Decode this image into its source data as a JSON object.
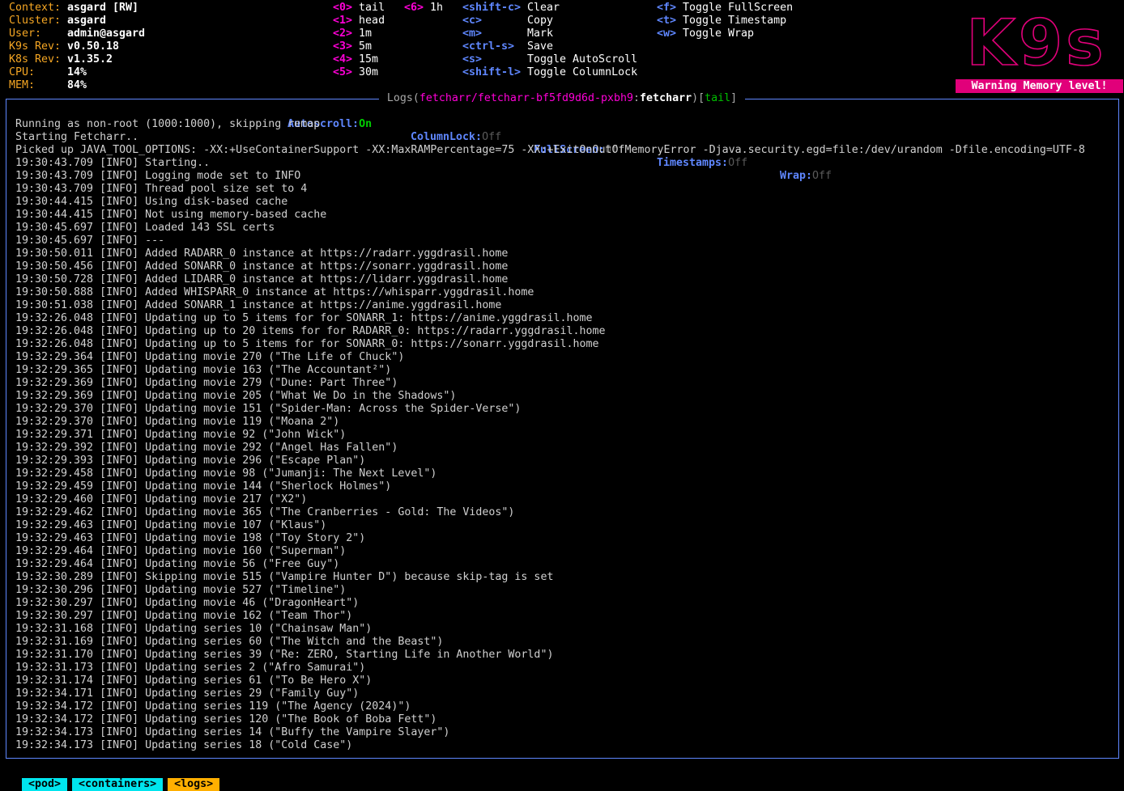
{
  "header": {
    "info": [
      {
        "label": "Context:",
        "value": "asgard [RW]"
      },
      {
        "label": "Cluster:",
        "value": "asgard"
      },
      {
        "label": "User:",
        "value": "admin@asgard"
      },
      {
        "label": "K9s Rev:",
        "value": "v0.50.18"
      },
      {
        "label": "K8s Rev:",
        "value": "v1.35.2"
      },
      {
        "label": "CPU:",
        "value": "14%"
      },
      {
        "label": "MEM:",
        "value": "84%"
      }
    ],
    "keybindings_col1": [
      {
        "key": "<0>",
        "desc": "tail"
      },
      {
        "key": "<1>",
        "desc": "head"
      },
      {
        "key": "<2>",
        "desc": "1m"
      },
      {
        "key": "<3>",
        "desc": "5m"
      },
      {
        "key": "<4>",
        "desc": "15m"
      },
      {
        "key": "<5>",
        "desc": "30m"
      }
    ],
    "keybindings_col2": [
      {
        "key": "<6>",
        "desc": "1h"
      }
    ],
    "keybindings_col3": [
      {
        "key": "<shift-c>",
        "desc": "Clear"
      },
      {
        "key": "<c>",
        "desc": "Copy"
      },
      {
        "key": "<m>",
        "desc": "Mark"
      },
      {
        "key": "<ctrl-s>",
        "desc": "Save"
      },
      {
        "key": "<s>",
        "desc": "Toggle AutoScroll"
      },
      {
        "key": "<shift-l>",
        "desc": "Toggle ColumnLock"
      }
    ],
    "keybindings_col4": [
      {
        "key": "<f>",
        "desc": "Toggle FullScreen"
      },
      {
        "key": "<t>",
        "desc": "Toggle Timestamp"
      },
      {
        "key": "<w>",
        "desc": "Toggle Wrap"
      }
    ],
    "logo_text": "K9s",
    "warning": "Warning Memory level!"
  },
  "frame": {
    "title_prefix": "Logs(",
    "title_path": "fetcharr/fetcharr-bf5fd9d6d-pxbh9",
    "title_sep": ":",
    "title_container": "fetcharr",
    "title_close": ")",
    "title_mode_open": "[",
    "title_mode": "tail",
    "title_mode_close": "]"
  },
  "status": [
    {
      "label": "Autoscroll:",
      "value": "On"
    },
    {
      "label": "ColumnLock:",
      "value": "Off"
    },
    {
      "label": "FullScreen:",
      "value": "Off"
    },
    {
      "label": "Timestamps:",
      "value": "Off"
    },
    {
      "label": "Wrap:",
      "value": "Off"
    }
  ],
  "logs": [
    "Running as non-root (1000:1000), skipping remap",
    "Starting Fetcharr..",
    "Picked up JAVA_TOOL_OPTIONS: -XX:+UseContainerSupport -XX:MaxRAMPercentage=75 -XX:+ExitOnOutOfMemoryError -Djava.security.egd=file:/dev/urandom -Dfile.encoding=UTF-8",
    "19:30:43.709 [INFO] Starting..",
    "19:30:43.709 [INFO] Logging mode set to INFO",
    "19:30:43.709 [INFO] Thread pool size set to 4",
    "19:30:44.415 [INFO] Using disk-based cache",
    "19:30:44.415 [INFO] Not using memory-based cache",
    "19:30:45.697 [INFO] Loaded 143 SSL certs",
    "19:30:45.697 [INFO] ---",
    "19:30:50.011 [INFO] Added RADARR_0 instance at https://radarr.yggdrasil.home",
    "19:30:50.456 [INFO] Added SONARR_0 instance at https://sonarr.yggdrasil.home",
    "19:30:50.728 [INFO] Added LIDARR_0 instance at https://lidarr.yggdrasil.home",
    "19:30:50.888 [INFO] Added WHISPARR_0 instance at https://whisparr.yggdrasil.home",
    "19:30:51.038 [INFO] Added SONARR_1 instance at https://anime.yggdrasil.home",
    "19:32:26.048 [INFO] Updating up to 5 items for for SONARR_1: https://anime.yggdrasil.home",
    "19:32:26.048 [INFO] Updating up to 20 items for for RADARR_0: https://radarr.yggdrasil.home",
    "19:32:26.048 [INFO] Updating up to 5 items for for SONARR_0: https://sonarr.yggdrasil.home",
    "19:32:29.364 [INFO] Updating movie 270 (\"The Life of Chuck\")",
    "19:32:29.365 [INFO] Updating movie 163 (\"The Accountant²\")",
    "19:32:29.369 [INFO] Updating movie 279 (\"Dune: Part Three\")",
    "19:32:29.369 [INFO] Updating movie 205 (\"What We Do in the Shadows\")",
    "19:32:29.370 [INFO] Updating movie 151 (\"Spider-Man: Across the Spider-Verse\")",
    "19:32:29.370 [INFO] Updating movie 119 (\"Moana 2\")",
    "19:32:29.371 [INFO] Updating movie 92 (\"John Wick\")",
    "19:32:29.392 [INFO] Updating movie 292 (\"Angel Has Fallen\")",
    "19:32:29.393 [INFO] Updating movie 296 (\"Escape Plan\")",
    "19:32:29.458 [INFO] Updating movie 98 (\"Jumanji: The Next Level\")",
    "19:32:29.459 [INFO] Updating movie 144 (\"Sherlock Holmes\")",
    "19:32:29.460 [INFO] Updating movie 217 (\"X2\")",
    "19:32:29.462 [INFO] Updating movie 365 (\"The Cranberries - Gold: The Videos\")",
    "19:32:29.463 [INFO] Updating movie 107 (\"Klaus\")",
    "19:32:29.463 [INFO] Updating movie 198 (\"Toy Story 2\")",
    "19:32:29.464 [INFO] Updating movie 160 (\"Superman\")",
    "19:32:29.464 [INFO] Updating movie 56 (\"Free Guy\")",
    "19:32:30.289 [INFO] Skipping movie 515 (\"Vampire Hunter D\") because skip-tag is set",
    "19:32:30.296 [INFO] Updating movie 527 (\"Timeline\")",
    "19:32:30.297 [INFO] Updating movie 46 (\"DragonHeart\")",
    "19:32:30.297 [INFO] Updating movie 162 (\"Team Thor\")",
    "19:32:31.168 [INFO] Updating series 10 (\"Chainsaw Man\")",
    "19:32:31.169 [INFO] Updating series 60 (\"The Witch and the Beast\")",
    "19:32:31.170 [INFO] Updating series 39 (\"Re: ZERO, Starting Life in Another World\")",
    "19:32:31.173 [INFO] Updating series 2 (\"Afro Samurai\")",
    "19:32:31.174 [INFO] Updating series 61 (\"To Be Hero X\")",
    "19:32:34.171 [INFO] Updating series 29 (\"Family Guy\")",
    "19:32:34.172 [INFO] Updating series 119 (\"The Agency (2024)\")",
    "19:32:34.172 [INFO] Updating series 120 (\"The Book of Boba Fett\")",
    "19:32:34.173 [INFO] Updating series 14 (\"Buffy the Vampire Slayer\")",
    "19:32:34.173 [INFO] Updating series 18 (\"Cold Case\")"
  ],
  "crumbs": [
    "<pod>",
    "<containers>",
    "<logs>"
  ],
  "colors": {
    "accent": "#5f87ff",
    "label": "#f5a623",
    "magenta": "#ff00d7",
    "warning_bg": "#e1007a",
    "crumb_cyan": "#00e5ee",
    "crumb_orange": "#ffaf00"
  }
}
